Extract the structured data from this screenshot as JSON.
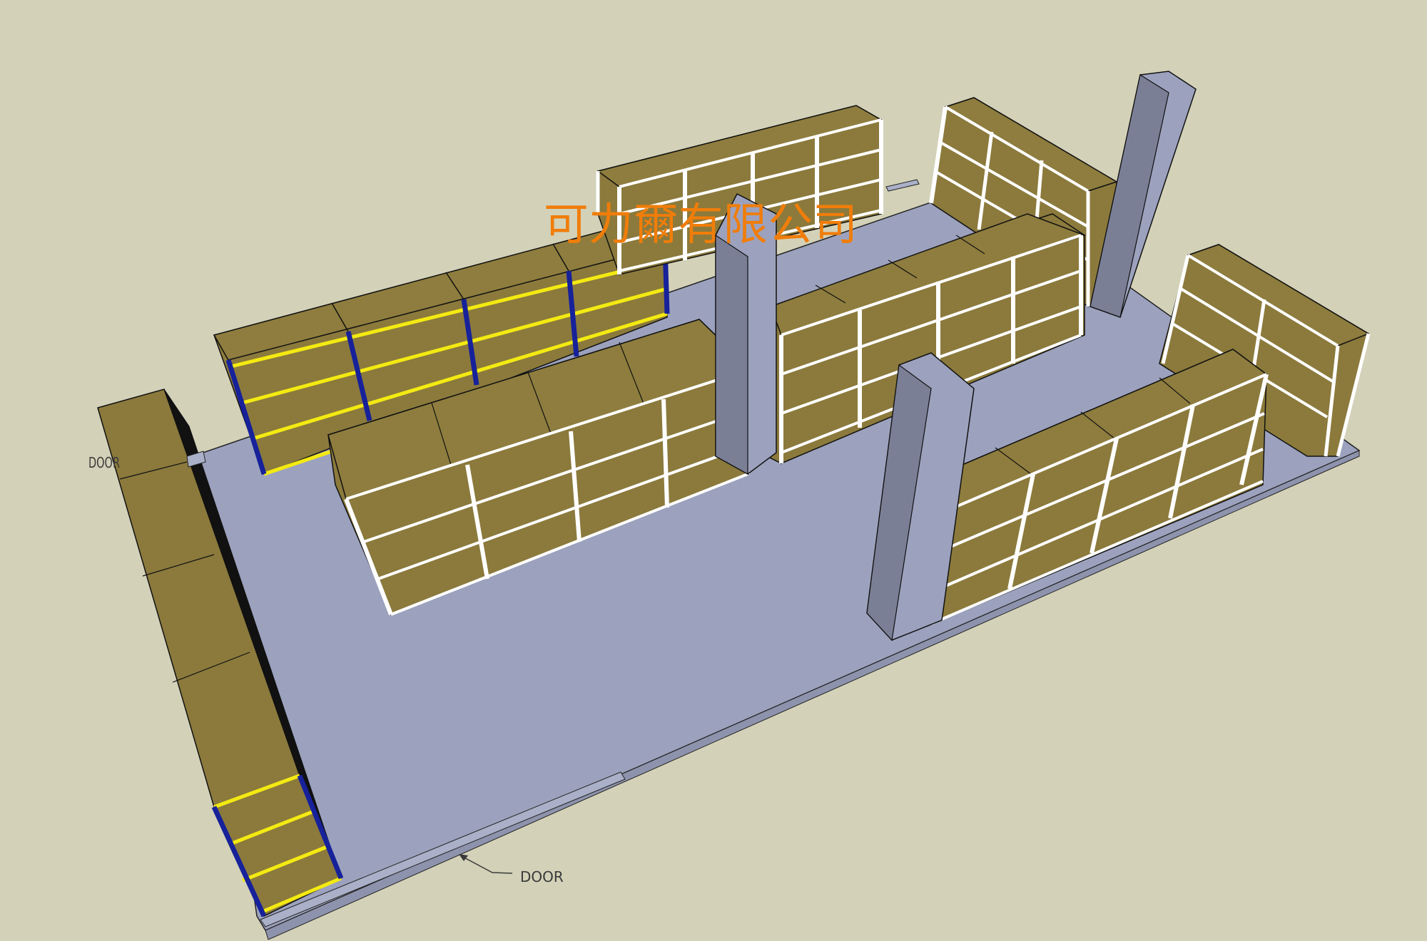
{
  "scene": {
    "background_color": "#d3d1b8",
    "floor_color": "#9ca2bd",
    "shelf_board_color": "#8b7a3c",
    "shelf_frame_color": "#ffffff",
    "column_color": "#7b7f96",
    "upright_blue_color": "#16219a",
    "edge_yellow_color": "#f4ea12",
    "outline_color": "#111111"
  },
  "labels": {
    "door_left": "DOOR",
    "door_bottom": "DOOR",
    "watermark": "可力爾有限公司"
  }
}
